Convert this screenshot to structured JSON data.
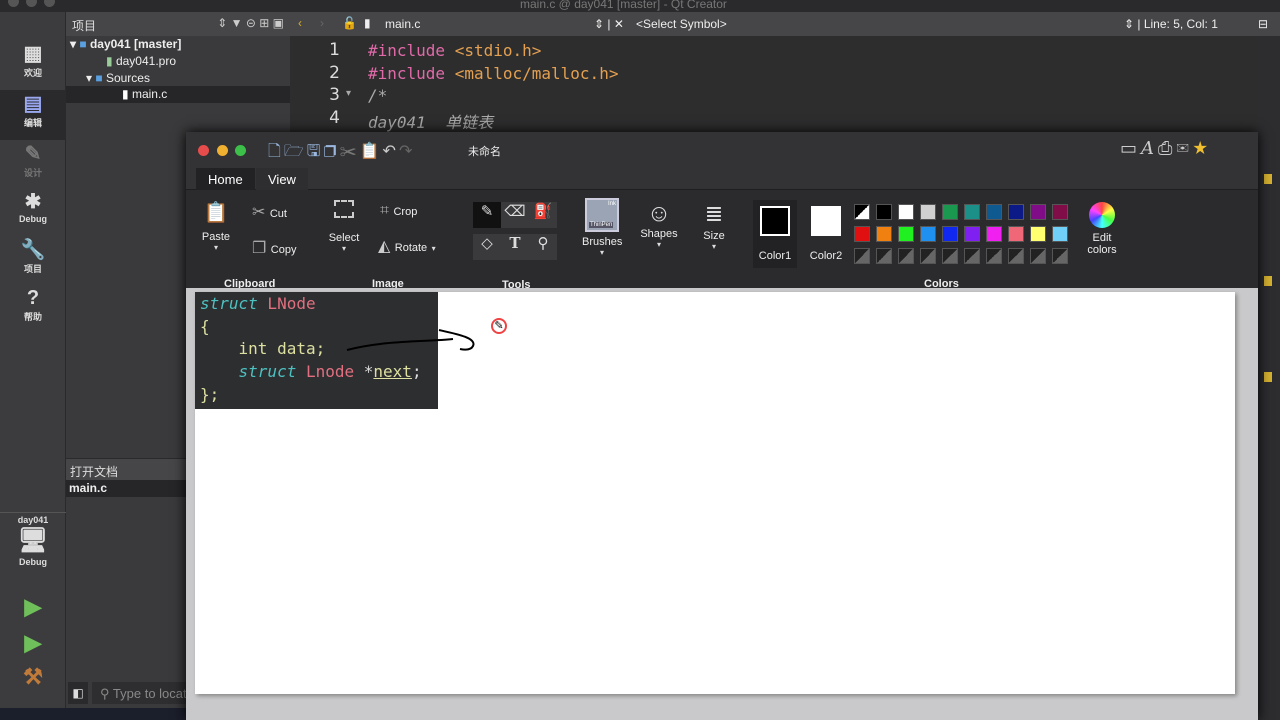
{
  "window_title": "main.c @ day041 [master] - Qt Creator",
  "modes": [
    {
      "label": "欢迎",
      "icon": "grid-icon"
    },
    {
      "label": "编辑",
      "icon": "document-icon"
    },
    {
      "label": "设计",
      "icon": "pen-icon"
    },
    {
      "label": "Debug",
      "icon": "bug-icon"
    },
    {
      "label": "项目",
      "icon": "wrench-icon"
    },
    {
      "label": "帮助",
      "icon": "help-icon"
    }
  ],
  "kit": {
    "project": "day041",
    "mode": "Debug"
  },
  "project_panel": {
    "title": "项目",
    "tree": [
      {
        "label": "day041 [master]"
      },
      {
        "label": "day041.pro"
      },
      {
        "label": "Sources"
      },
      {
        "label": "main.c"
      }
    ]
  },
  "open_docs": {
    "title": "打开文档",
    "items": [
      "main.c"
    ]
  },
  "locator": {
    "placeholder": "Type to locate"
  },
  "editor": {
    "file": "main.c",
    "symbol": "<Select Symbol>",
    "position": "Line: 5, Col: 1",
    "lines": [
      {
        "n": "1",
        "a": "#include",
        "b": " <stdio.h>"
      },
      {
        "n": "2",
        "a": "#include",
        "b": " <malloc/malloc.h>"
      },
      {
        "n": "3",
        "a": "/*",
        "b": ""
      },
      {
        "n": "4",
        "a": "day041  单链表",
        "b": ""
      }
    ]
  },
  "paint": {
    "title": "未命名",
    "tabs": [
      "Home",
      "View"
    ],
    "clipboard": {
      "paste": "Paste",
      "cut": "Cut",
      "copy": "Copy",
      "group": "Clipboard"
    },
    "image": {
      "select": "Select",
      "crop": "Crop",
      "rotate": "Rotate",
      "group": "Image"
    },
    "tools": {
      "group": "Tools"
    },
    "brushes": "Brushes",
    "brush_badge_top": "Ink",
    "brush_badge": "ThinPen",
    "shapes": "Shapes",
    "size": "Size",
    "color1": "Color1",
    "color2": "Color2",
    "edit_colors": "Edit colors",
    "colors_group": "Colors",
    "color1_value": "#000000",
    "color2_value": "#ffffff",
    "palette_row1": [
      "#000000/#ffffff",
      "#000000",
      "#ffffff",
      "#d0d0d0",
      "#1a9850",
      "#1a9088",
      "#0e5a90",
      "#0c1a88",
      "#800c88",
      "#800c48"
    ],
    "palette_row2": [
      "#e01010",
      "#f08010",
      "#20f020",
      "#2090f0",
      "#1028f0",
      "#8020f0",
      "#f020f0",
      "#f06878",
      "#ffff70",
      "#70d0f8"
    ],
    "snippet": {
      "l1a": "struct",
      "l1b": " LNode",
      "l2": "{",
      "l3": "    int data;",
      "l4a": "    struct",
      "l4b": " Lnode ",
      "l4c": "*",
      "l4d": "next",
      ";": ";",
      "l5": "};"
    }
  }
}
